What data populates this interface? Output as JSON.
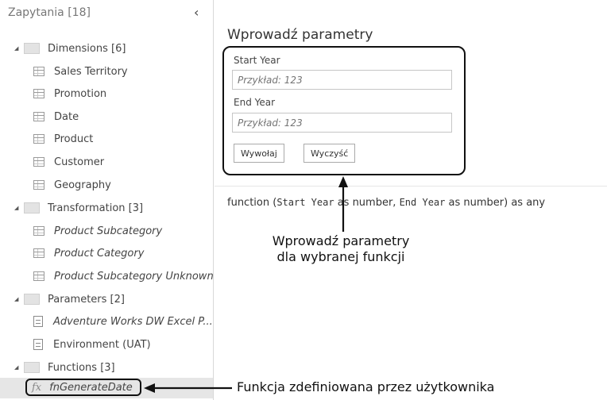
{
  "sidebar": {
    "header": "Zapytania [18]",
    "collapse_icon": "‹",
    "groups": [
      {
        "label": "Dimensions [6]",
        "items": [
          "Sales Territory",
          "Promotion",
          "Date",
          "Product",
          "Customer",
          "Geography"
        ]
      },
      {
        "label": "Transformation [3]",
        "items": [
          "Product Subcategory",
          "Product Category",
          "Product Subcategory Unknown"
        ]
      },
      {
        "label": "Parameters [2]",
        "items": [
          "Adventure Works DW Excel P...",
          "Environment (UAT)"
        ]
      },
      {
        "label": "Functions [3]",
        "items": [
          "fnGenerateDate"
        ]
      }
    ],
    "fx_glyph": "fx"
  },
  "panel": {
    "title": "Wprowadź parametry",
    "fields": [
      {
        "label": "Start Year",
        "placeholder": "Przykład: 123"
      },
      {
        "label": "End Year",
        "placeholder": "Przykład: 123"
      }
    ],
    "invoke_label": "Wywołaj",
    "clear_label": "Wyczyść"
  },
  "signature": {
    "prefix": "function (",
    "p1": "Start Year",
    "t1": " as number, ",
    "p2": "End Year",
    "t2": " as number) as any"
  },
  "annotations": {
    "params_line1": "Wprowadź parametry",
    "params_line2": "dla wybranej funkcji",
    "user_function": "Funkcja zdefiniowana przez użytkownika"
  }
}
